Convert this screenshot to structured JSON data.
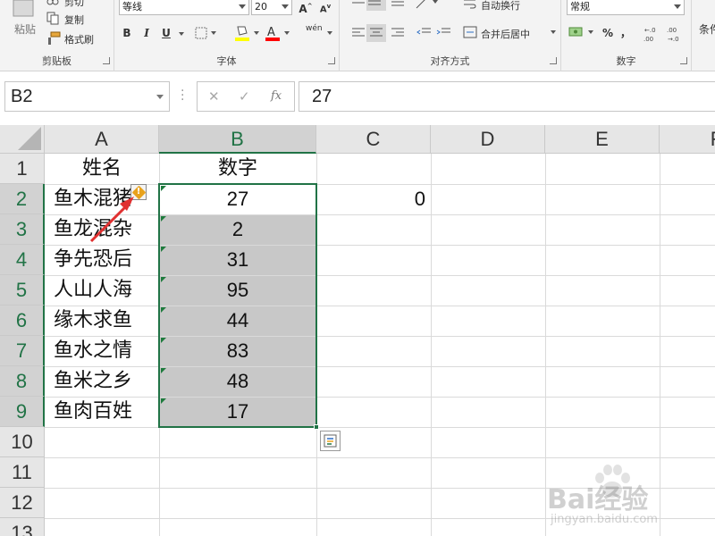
{
  "ribbon": {
    "clipboard": {
      "paste_label": "粘贴",
      "cut_label": "剪切",
      "copy_label": "复制",
      "format_painter_label": "格式刷",
      "group_label": "剪贴板"
    },
    "font": {
      "font_name": "等线",
      "font_size": "20",
      "grow_label": "A",
      "shrink_label": "A",
      "bold_label": "B",
      "italic_label": "I",
      "underline_label": "U",
      "phonetic_label": "wén",
      "group_label": "字体",
      "fill_color": "#ffff00",
      "font_color": "#ff0000"
    },
    "alignment": {
      "wrap_text_label": "自动换行",
      "merge_center_label": "合并后居中",
      "group_label": "对齐方式"
    },
    "number": {
      "format_value": "常规",
      "percent_label": "%",
      "comma_label": "，",
      "inc_decimal_label": ".00→.0",
      "dec_decimal_label": ".00→.0",
      "group_label": "数字"
    },
    "conditional": {
      "label": "条件"
    }
  },
  "formula_bar": {
    "name_box": "B2",
    "cancel_symbol": "✕",
    "enter_symbol": "✓",
    "fx_symbol": "fx",
    "formula_value": "27"
  },
  "sheet": {
    "columns": [
      "A",
      "B",
      "C",
      "D",
      "E",
      "F"
    ],
    "rows": [
      "1",
      "2",
      "3",
      "4",
      "5",
      "6",
      "7",
      "8",
      "9",
      "10",
      "11",
      "12",
      "13"
    ],
    "a_header": "姓名",
    "b_header": "数字",
    "names": [
      "鱼木混猪",
      "鱼龙混杂",
      "争先恐后",
      "人山人海",
      "缘木求鱼",
      "鱼水之情",
      "鱼米之乡",
      "鱼肉百姓"
    ],
    "numbers": [
      "27",
      "2",
      "31",
      "95",
      "44",
      "83",
      "48",
      "17"
    ],
    "c2_value": "0",
    "selected_range": "B2:B9",
    "selection_color": "#217346"
  },
  "watermark": {
    "brand": "Bai经验",
    "url": "jingyan.baidu.com"
  }
}
